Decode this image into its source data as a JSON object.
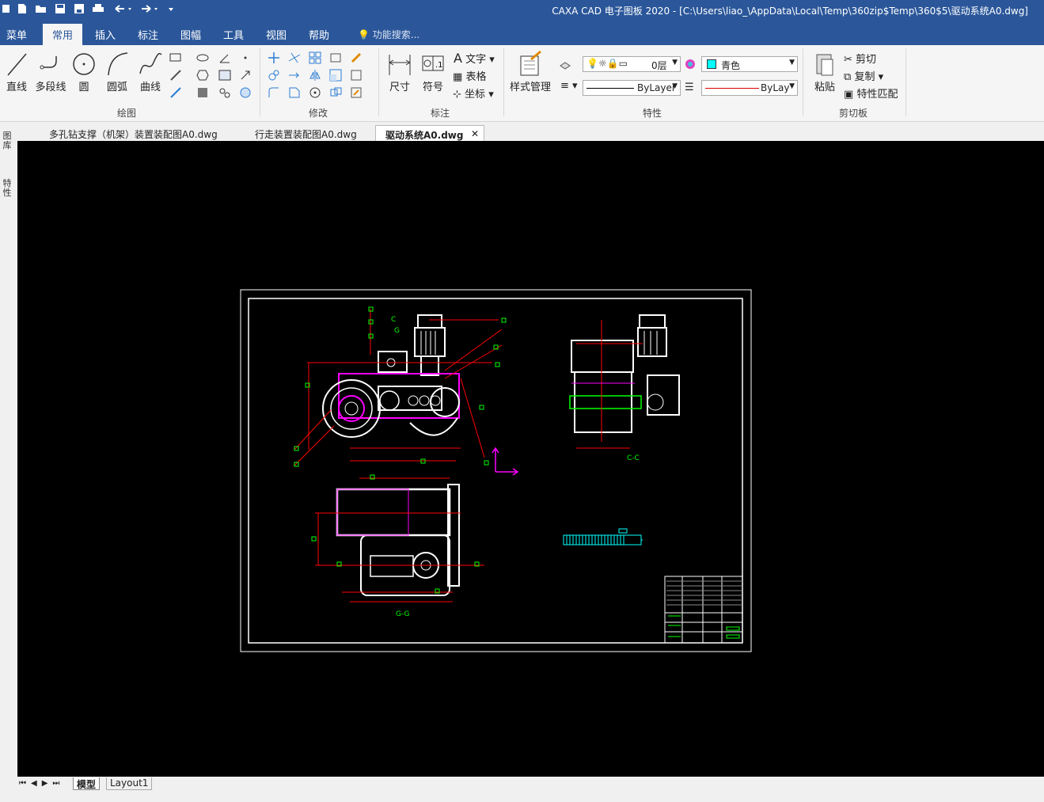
{
  "window": {
    "title": "CAXA CAD 电子图板 2020 - [C:\\Users\\liao_\\AppData\\Local\\Temp\\360zip$Temp\\360$5\\驱动系统A0.dwg]"
  },
  "menu_tabs": [
    "菜单",
    "常用",
    "插入",
    "标注",
    "图幅",
    "工具",
    "视图",
    "帮助"
  ],
  "search_placeholder": "功能搜索...",
  "ribbon": {
    "draw": {
      "line": "直线",
      "polyline": "多段线",
      "circle": "圆",
      "arc": "圆弧",
      "curve": "曲线",
      "group": "绘图"
    },
    "modify": {
      "group": "修改"
    },
    "annotate": {
      "dimension": "尺寸",
      "symbol": "符号",
      "text": "文字",
      "table": "表格",
      "coordinate": "坐标",
      "group": "标注"
    },
    "properties": {
      "style_manager": "样式管理",
      "layer": "0层",
      "color": "青色",
      "linetype": "ByLayer",
      "lineweight": "ByLay",
      "group": "特性"
    },
    "clipboard": {
      "paste": "粘贴",
      "cut": "剪切",
      "copy": "复制",
      "match": "特性匹配",
      "group": "剪切板"
    }
  },
  "doc_tabs": [
    {
      "label": "多孔钻支撑（机架）装置装配图A0.dwg",
      "active": false
    },
    {
      "label": "行走装置装配图A0.dwg",
      "active": false
    },
    {
      "label": "驱动系统A0.dwg",
      "active": true
    }
  ],
  "left_palette": [
    "图库",
    "特性"
  ],
  "drawing": {
    "section_label_1": "C-C",
    "section_label_2": "G-G",
    "marker_c": "C",
    "marker_g": "G"
  },
  "layout_tabs": [
    "模型",
    "Layout1"
  ],
  "colors": {
    "titlebar": "#2b579a",
    "canvas": "#000000",
    "cyan": "#00ffff",
    "magenta": "#ff00ff",
    "red": "#ff0000",
    "green": "#00ff00"
  }
}
